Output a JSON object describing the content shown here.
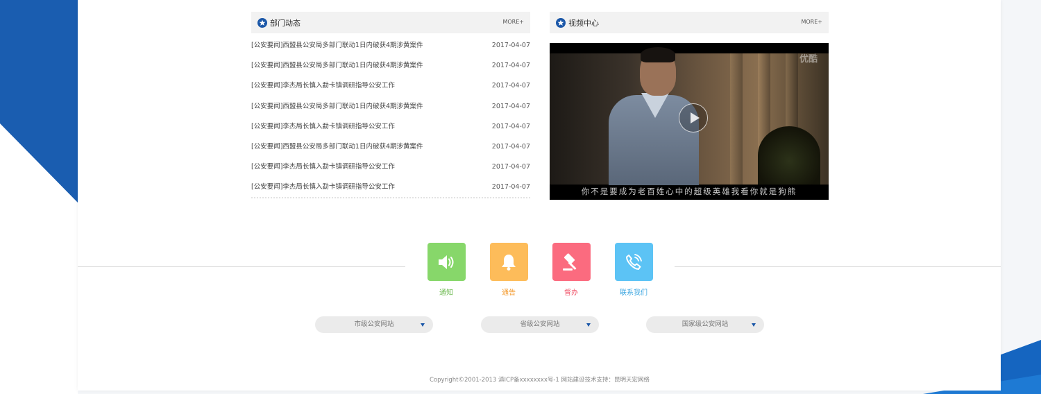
{
  "news_panel": {
    "title": "部门动态",
    "more": "MORE+",
    "items": [
      {
        "title": "[公安要闻]西盟县公安局多部门联动1日内破获4期涉黄案件",
        "date": "2017-04-07"
      },
      {
        "title": "[公安要闻]西盟县公安局多部门联动1日内破获4期涉黄案件",
        "date": "2017-04-07"
      },
      {
        "title": "[公安要闻]李杰局长慎入勐卡镇调研指导公安工作",
        "date": "2017-04-07"
      },
      {
        "title": "[公安要闻]西盟县公安局多部门联动1日内破获4期涉黄案件",
        "date": "2017-04-07"
      },
      {
        "title": "[公安要闻]李杰局长慎入勐卡镇调研指导公安工作",
        "date": "2017-04-07"
      },
      {
        "title": "[公安要闻]西盟县公安局多部门联动1日内破获4期涉黄案件",
        "date": "2017-04-07"
      },
      {
        "title": "[公安要闻]李杰局长慎入勐卡镇调研指导公安工作",
        "date": "2017-04-07"
      },
      {
        "title": "[公安要闻]李杰局长慎入勐卡镇调研指导公安工作",
        "date": "2017-04-07"
      }
    ]
  },
  "video_panel": {
    "title": "视频中心",
    "more": "MORE+",
    "watermark": "优酷",
    "subtitle": "你不是要成为老百姓心中的超级英雄我看你就是狗熊"
  },
  "shortcuts": [
    {
      "label": "通知",
      "icon": "speaker-icon",
      "color": "#87d76a"
    },
    {
      "label": "通告",
      "icon": "bell-icon",
      "color": "#fdbc5a"
    },
    {
      "label": "督办",
      "icon": "gavel-icon",
      "color": "#fb6b7f"
    },
    {
      "label": "联系我们",
      "icon": "phone-icon",
      "color": "#5cc3f5"
    }
  ],
  "site_links": [
    {
      "label": "市级公安网站"
    },
    {
      "label": "省级公安网站"
    },
    {
      "label": "国家级公安网站"
    }
  ],
  "footer": {
    "copyright": "Copyright©2001-2013 滇ICP备xxxxxxxx号-1  网站建设技术支持：昆明天宏网络"
  }
}
